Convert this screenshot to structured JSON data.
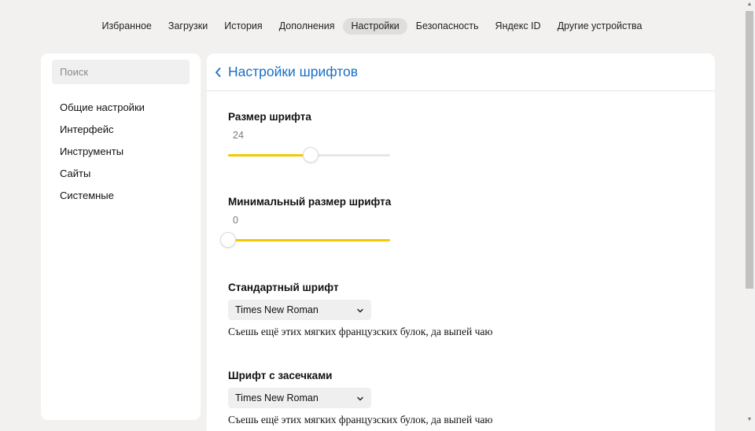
{
  "nav": {
    "tabs": [
      {
        "label": "Избранное"
      },
      {
        "label": "Загрузки"
      },
      {
        "label": "История"
      },
      {
        "label": "Дополнения"
      },
      {
        "label": "Настройки",
        "active": true
      },
      {
        "label": "Безопасность"
      },
      {
        "label": "Яндекс ID"
      },
      {
        "label": "Другие устройства"
      }
    ]
  },
  "sidebar": {
    "search_placeholder": "Поиск",
    "items": [
      {
        "label": "Общие настройки"
      },
      {
        "label": "Интерфейс"
      },
      {
        "label": "Инструменты"
      },
      {
        "label": "Сайты"
      },
      {
        "label": "Системные"
      }
    ]
  },
  "page": {
    "title": "Настройки шрифтов",
    "back_icon": "chevron-left-icon"
  },
  "settings": {
    "font_size": {
      "label": "Размер шрифта",
      "value": "24",
      "level": 0.51
    },
    "min_font_size": {
      "label": "Минимальный размер шрифта",
      "value": "0",
      "level": 0
    },
    "standard_font": {
      "label": "Стандартный шрифт",
      "selected": "Times New Roman",
      "preview": "Съешь ещё этих мягких французских булок, да выпей чаю"
    },
    "serif_font": {
      "label": "Шрифт с засечками",
      "selected": "Times New Roman",
      "preview": "Съешь ещё этих мягких французских булок, да выпей чаю"
    }
  },
  "colors": {
    "accent": "#f5c900",
    "link": "#1a6fc4",
    "background": "#f2f1f0"
  }
}
